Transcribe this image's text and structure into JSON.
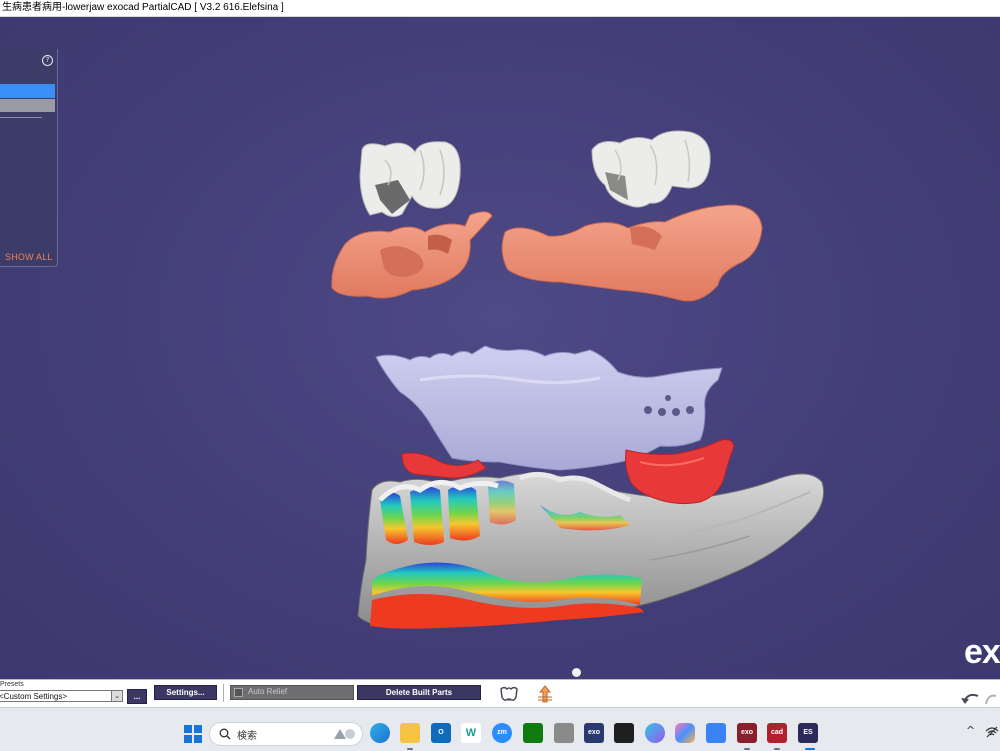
{
  "window": {
    "title": "生病患者病用-lowerjaw exocad PartialCAD [ V3.2 616.Elefsina ]"
  },
  "side_panel": {
    "help_glyph": "?",
    "show_all_label": "SHOW ALL"
  },
  "viewport": {
    "watermark": "exo"
  },
  "toolbar": {
    "presets_label": "Presets",
    "preset_value": "<Custom Settings>",
    "preset_arrow_glyph": "⌄",
    "more_button_label": "...",
    "settings_button_label": "Settings...",
    "auto_relief_label": "Auto Relief",
    "delete_built_parts_label": "Delete Built Parts"
  },
  "taskbar": {
    "search_placeholder": "検索",
    "apps": [
      {
        "name": "edge",
        "label": ""
      },
      {
        "name": "file-explorer",
        "label": ""
      },
      {
        "name": "outlook",
        "label": "O"
      },
      {
        "name": "word-online",
        "label": "W"
      },
      {
        "name": "zoom",
        "label": "zm"
      },
      {
        "name": "xbox",
        "label": ""
      },
      {
        "name": "dental-app",
        "label": ""
      },
      {
        "name": "exoview",
        "label": "exo"
      },
      {
        "name": "terminal",
        "label": ""
      },
      {
        "name": "photos",
        "label": ""
      },
      {
        "name": "copilot",
        "label": ""
      },
      {
        "name": "notepad",
        "label": ""
      },
      {
        "name": "exocad",
        "label": "exo"
      },
      {
        "name": "dentalcad",
        "label": "cad"
      },
      {
        "name": "exoplan",
        "label": "ES"
      }
    ],
    "tray_chevron": "^"
  },
  "colors": {
    "viewport_bg": "#433e78",
    "toolbar_button": "#3b3763",
    "selected_item": "#3a8ef6",
    "show_all": "#f08050",
    "gingiva": "#ee8e74",
    "palatal_plate": "#bdbde6",
    "relief_red": "#e8393a",
    "crowns": "#ececea"
  }
}
